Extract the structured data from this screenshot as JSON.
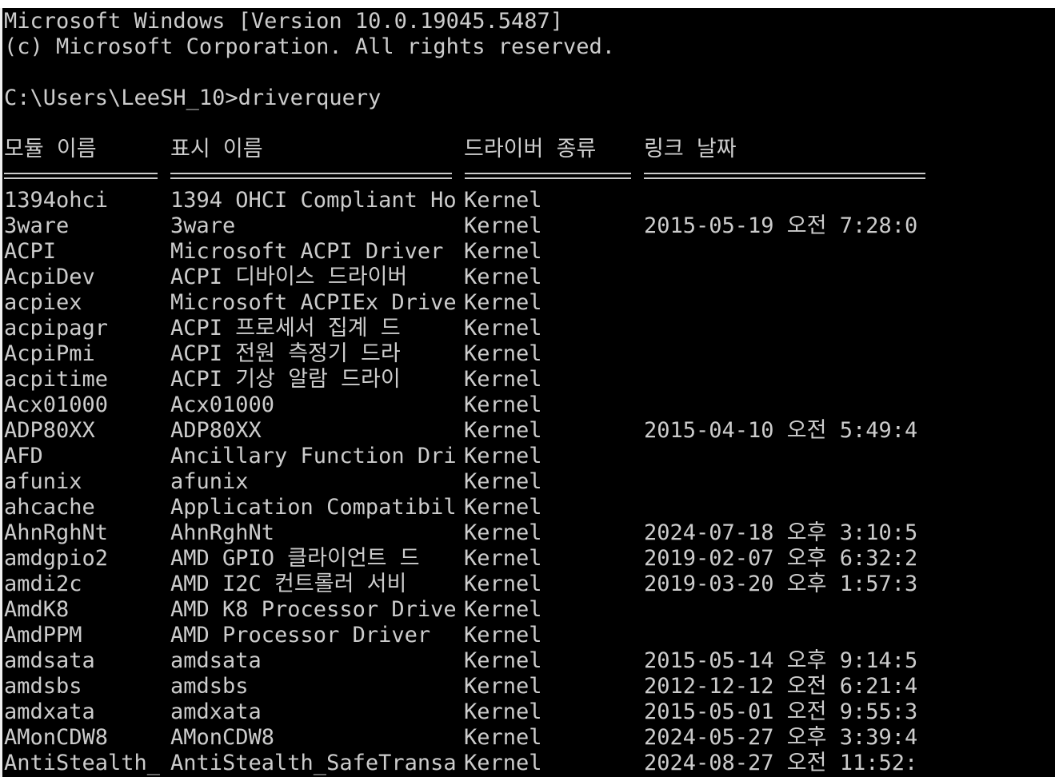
{
  "console": {
    "banner_line1": "Microsoft Windows [Version 10.0.19045.5487]",
    "banner_line2": "(c) Microsoft Corporation. All rights reserved.",
    "prompt_line": "C:\\Users\\LeeSH_10>driverquery"
  },
  "table": {
    "headers": {
      "module": "모듈 이름",
      "display": "표시 이름",
      "type": "드라이버 종류",
      "date": "링크 날짜"
    },
    "rows": [
      {
        "module": "1394ohci",
        "display": "1394 OHCI Compliant Ho",
        "type": "Kernel",
        "date": ""
      },
      {
        "module": "3ware",
        "display": "3ware",
        "type": "Kernel",
        "date": "2015-05-19 오전 7:28:0"
      },
      {
        "module": "ACPI",
        "display": "Microsoft ACPI Driver",
        "type": "Kernel",
        "date": ""
      },
      {
        "module": "AcpiDev",
        "display": "ACPI 디바이스 드라이버",
        "type": "Kernel",
        "date": ""
      },
      {
        "module": "acpiex",
        "display": "Microsoft ACPIEx Drive",
        "type": "Kernel",
        "date": ""
      },
      {
        "module": "acpipagr",
        "display": "ACPI 프로세서 집계 드",
        "type": "Kernel",
        "date": ""
      },
      {
        "module": "AcpiPmi",
        "display": "ACPI 전원 측정기 드라",
        "type": "Kernel",
        "date": ""
      },
      {
        "module": "acpitime",
        "display": "ACPI 기상 알람 드라이",
        "type": "Kernel",
        "date": ""
      },
      {
        "module": "Acx01000",
        "display": "Acx01000",
        "type": "Kernel",
        "date": ""
      },
      {
        "module": "ADP80XX",
        "display": "ADP80XX",
        "type": "Kernel",
        "date": "2015-04-10 오전 5:49:4"
      },
      {
        "module": "AFD",
        "display": "Ancillary Function Dri",
        "type": "Kernel",
        "date": ""
      },
      {
        "module": "afunix",
        "display": "afunix",
        "type": "Kernel",
        "date": ""
      },
      {
        "module": "ahcache",
        "display": "Application Compatibil",
        "type": "Kernel",
        "date": ""
      },
      {
        "module": "AhnRghNt",
        "display": "AhnRghNt",
        "type": "Kernel",
        "date": "2024-07-18 오후 3:10:5"
      },
      {
        "module": "amdgpio2",
        "display": "AMD GPIO 클라이언트 드",
        "type": "Kernel",
        "date": "2019-02-07 오후 6:32:2"
      },
      {
        "module": "amdi2c",
        "display": "AMD I2C 컨트롤러 서비",
        "type": "Kernel",
        "date": "2019-03-20 오후 1:57:3"
      },
      {
        "module": "AmdK8",
        "display": "AMD K8 Processor Drive",
        "type": "Kernel",
        "date": ""
      },
      {
        "module": "AmdPPM",
        "display": "AMD Processor Driver",
        "type": "Kernel",
        "date": ""
      },
      {
        "module": "amdsata",
        "display": "amdsata",
        "type": "Kernel",
        "date": "2015-05-14 오후 9:14:5"
      },
      {
        "module": "amdsbs",
        "display": "amdsbs",
        "type": "Kernel",
        "date": "2012-12-12 오전 6:21:4"
      },
      {
        "module": "amdxata",
        "display": "amdxata",
        "type": "Kernel",
        "date": "2015-05-01 오전 9:55:3"
      },
      {
        "module": "AMonCDW8",
        "display": "AMonCDW8",
        "type": "Kernel",
        "date": "2024-05-27 오후 3:39:4"
      },
      {
        "module": "AntiStealth_",
        "display": "AntiStealth_SafeTransa",
        "type": "Kernel",
        "date": "2024-08-27 오전 11:52:"
      }
    ]
  },
  "colors": {
    "background": "#000000",
    "text": "#cccccc"
  }
}
